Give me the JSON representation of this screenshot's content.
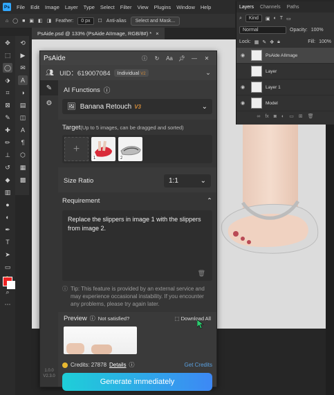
{
  "menubar": {
    "logo": "Ps",
    "items": [
      "File",
      "Edit",
      "Image",
      "Layer",
      "Type",
      "Select",
      "Filter",
      "View",
      "Plugins",
      "Window",
      "Help"
    ]
  },
  "optionsbar": {
    "feather_label": "Feather:",
    "feather_value": "0 px",
    "antialias_label": "Anti-alias",
    "select_mask_label": "Select and Mask..."
  },
  "document": {
    "tab_title": "PsAide.psd @ 133% (PsAide AIImage, RGB/8#) *",
    "close": "×"
  },
  "layers_panel": {
    "tabs": [
      "Layers",
      "Channels",
      "Paths"
    ],
    "filter": "Kind",
    "blend_mode": "Normal",
    "opacity_label": "Opacity:",
    "opacity_value": "100%",
    "lock_label": "Lock:",
    "fill_label": "Fill:",
    "fill_value": "100%",
    "layers": [
      {
        "name": "PsAide AIImage",
        "visible": true,
        "active": true
      },
      {
        "name": "Layer",
        "visible": false,
        "active": false
      },
      {
        "name": "Layer 1",
        "visible": true,
        "active": false
      },
      {
        "name": "Model",
        "visible": true,
        "active": false
      }
    ]
  },
  "plugin": {
    "title": "PsAide",
    "title_icons": [
      "info-icon",
      "refresh-icon",
      "font-icon",
      "pin-icon",
      "minimize-icon",
      "close-icon"
    ],
    "uid_label": "UID：619007084",
    "plan": "Individual",
    "plan_tag": "V2",
    "version": "1.0.0\nV2.3.0",
    "ai_functions_label": "AI Functions",
    "ai_function_value": "Banana Retouch",
    "ai_function_tag": "V3",
    "target_label": "Target",
    "target_hint": "(Up to 5 images, can be dragged and sorted)",
    "target_images": [
      "1",
      "2"
    ],
    "size_ratio_label": "Size Ratio",
    "size_ratio_value": "1:1",
    "requirement_label": "Requirement",
    "requirement_text": "Replace the slippers in image 1 with the slippers from image 2.",
    "tip_text": "Tip: This feature is provided by an external service and may experience occasional instability. If you encounter any problems, please try again later.",
    "preview_label": "Preview",
    "not_satisfied": "Not satisfied?",
    "download_all": "Download All",
    "credits_label": "Credits: 27878",
    "details_label": "Details",
    "get_credits": "Get Credits",
    "generate_label": "Generate immediately"
  },
  "colors": {
    "accent": "#3d88f5",
    "accent_start": "#1ecfd8",
    "v3_tag": "#d08a3a",
    "link": "#5aa0e0"
  }
}
